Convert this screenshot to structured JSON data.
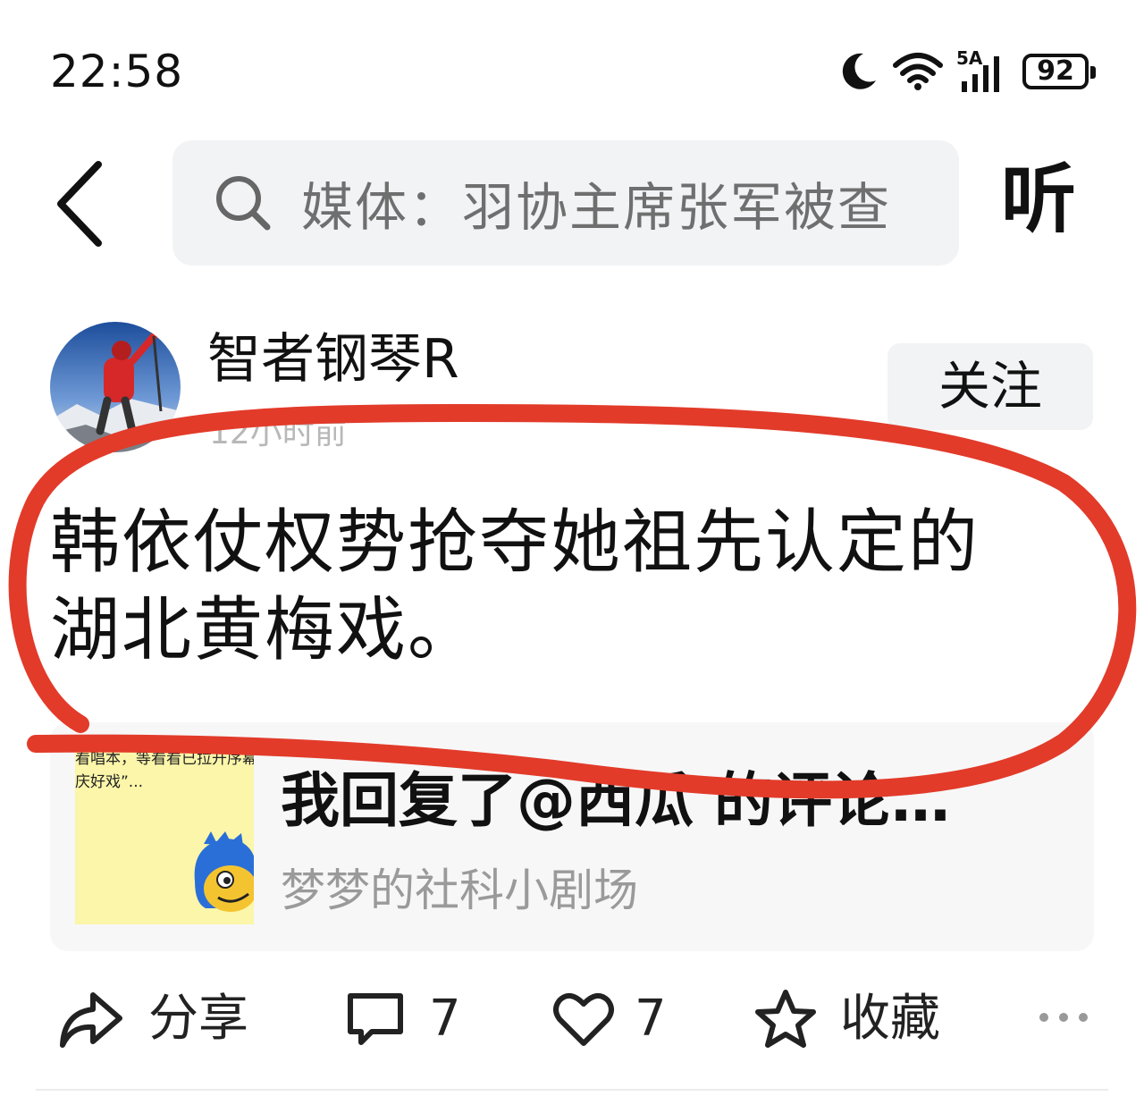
{
  "status_bar": {
    "time": "22:58",
    "network_label": "5A",
    "battery": "92",
    "icons": [
      "moon-icon",
      "wifi-icon",
      "cellular-signal-icon",
      "battery-icon"
    ]
  },
  "header": {
    "search_placeholder": "媒体：羽协主席张军被查",
    "listen_label": "听"
  },
  "post": {
    "author": "智者钢琴R",
    "time": "12小时前",
    "follow_label": "关注",
    "text_line1": "韩依仗权势抢夺她祖先认定的",
    "text_line2": "湖北黄梅戏。"
  },
  "quote": {
    "thumb_line1": "看唱本，等看看已拉开序幕",
    "thumb_line2": "庆好戏”...",
    "title": "我回复了@西瓜 的评论…",
    "source": "梦梦的社科小剧场"
  },
  "actions": {
    "share_label": "分享",
    "comment_count": "7",
    "like_count": "7",
    "favorite_label": "收藏"
  },
  "colors": {
    "annotation_red": "#e23b2a",
    "search_bg": "#f2f3f5",
    "card_bg": "#f7f7f8",
    "thumb_bg": "#fbf6a9"
  }
}
